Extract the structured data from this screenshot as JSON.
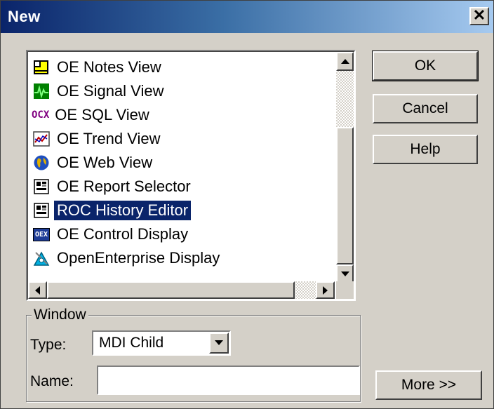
{
  "window": {
    "title": "New",
    "close_glyph": "✕"
  },
  "list": {
    "items": [
      {
        "label": "OE Notes View",
        "icon": "notes-icon",
        "selected": false
      },
      {
        "label": "OE Signal View",
        "icon": "signal-icon",
        "selected": false
      },
      {
        "label": "OE SQL View",
        "icon": "ocx-icon",
        "icon_text": "OCX",
        "selected": false
      },
      {
        "label": "OE Trend View",
        "icon": "trend-icon",
        "selected": false
      },
      {
        "label": "OE Web View",
        "icon": "globe-icon",
        "selected": false
      },
      {
        "label": "OE Report Selector",
        "icon": "report-icon",
        "selected": false
      },
      {
        "label": "ROC History Editor",
        "icon": "report-icon",
        "selected": true
      },
      {
        "label": "OE Control Display",
        "icon": "oex-icon",
        "icon_text": "OEX",
        "selected": false
      },
      {
        "label": "OpenEnterprise Display",
        "icon": "display-icon",
        "selected": false
      }
    ]
  },
  "buttons": {
    "ok": "OK",
    "cancel": "Cancel",
    "help": "Help",
    "more": "More >>"
  },
  "window_group": {
    "legend": "Window",
    "type_label": "Type:",
    "type_value": "MDI Child",
    "name_label": "Name:",
    "name_value": ""
  },
  "colors": {
    "selection": "#0a246a",
    "title_start": "#0a246a",
    "title_end": "#a6caf0"
  }
}
